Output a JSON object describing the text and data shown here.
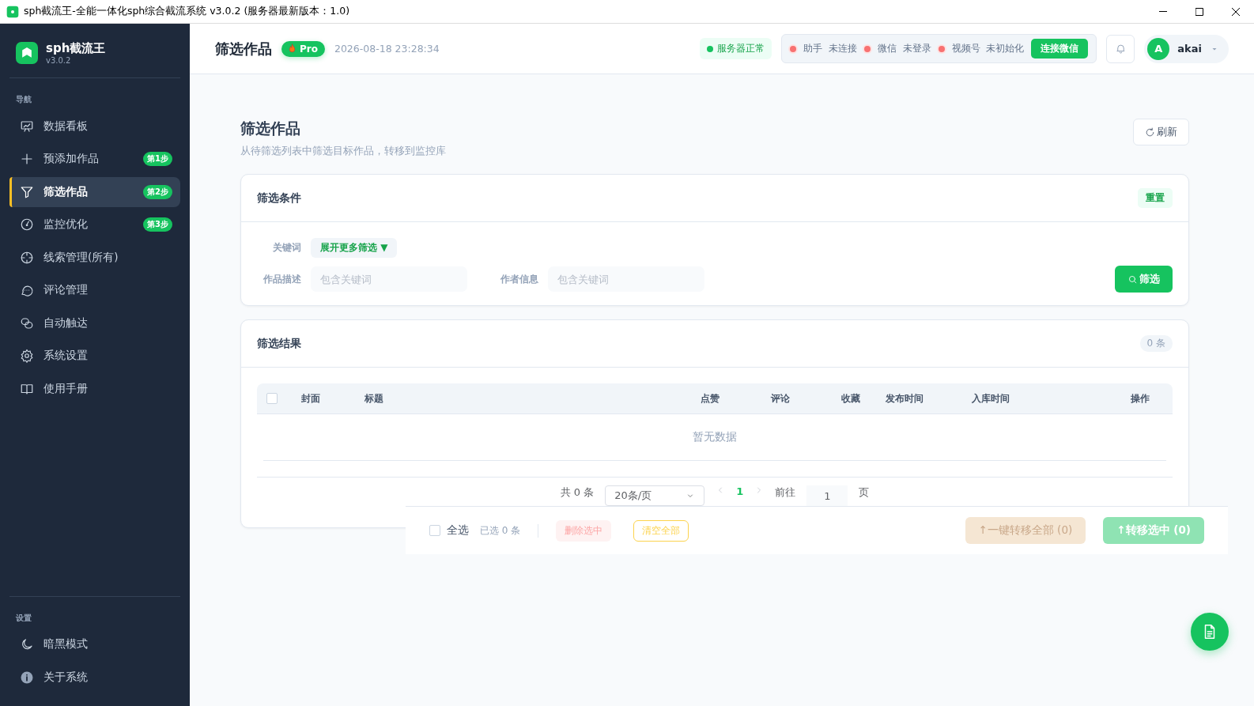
{
  "window": {
    "title": "sph截流王-全能一体化sph综合截流系统 v3.0.2 (服务器最新版本：1.0)"
  },
  "sidebar": {
    "brand": {
      "name": "sph截流王",
      "version": "v3.0.2"
    },
    "sections": [
      {
        "label": "导航",
        "items": [
          {
            "label": "数据看板",
            "selected": false
          },
          {
            "label": "预添加作品",
            "badge": "第1步",
            "selected": false
          },
          {
            "label": "筛选作品",
            "badge": "第2步",
            "selected": true
          },
          {
            "label": "监控优化",
            "badge": "第3步",
            "selected": false
          },
          {
            "label": "线索管理(所有)",
            "selected": false
          },
          {
            "label": "评论管理",
            "selected": false
          },
          {
            "label": "自动触达",
            "selected": false
          },
          {
            "label": "系统设置",
            "selected": false
          },
          {
            "label": "使用手册",
            "selected": false
          }
        ]
      },
      {
        "label": "设置",
        "items": [
          {
            "label": "暗黑模式",
            "selected": false
          },
          {
            "label": "关于系统",
            "selected": false
          }
        ]
      }
    ]
  },
  "header": {
    "title": "筛选作品",
    "badge": "Pro",
    "time": "2026-08-18 23:28:34",
    "server_status": {
      "label": "服务器正常",
      "ok": true
    },
    "statuses": [
      {
        "name": "助手",
        "value": "未连接",
        "ok": false
      },
      {
        "name": "微信",
        "value": "未登录",
        "ok": false
      },
      {
        "name": "视频号",
        "value": "未初始化",
        "ok": false
      }
    ],
    "connect_button": "连接微信",
    "user": {
      "avatar": "A",
      "name": "akai"
    }
  },
  "page": {
    "title": "筛选作品",
    "subtitle": "从待筛选列表中筛选目标作品，转移到监控库",
    "refresh_button": "刷新"
  },
  "filter": {
    "title": "筛选条件",
    "reset_button": "重置",
    "keyword_label": "关键词",
    "expand_button": "展开更多筛选 ▼",
    "fields": [
      {
        "label": "作品描述",
        "placeholder": "包含关键词"
      },
      {
        "label": "作者信息",
        "placeholder": "包含关键词"
      }
    ],
    "filter_button": "筛选"
  },
  "results": {
    "title": "筛选结果",
    "count": "0 条",
    "header_checked": false,
    "columns": [
      "封面",
      "标题",
      "点赞",
      "评论",
      "收藏",
      "发布时间",
      "入库时间",
      "操作"
    ],
    "empty": "暂无数据",
    "pagination": {
      "total": "共 0 条",
      "page_size": "20条/页",
      "pages": [
        {
          "label": "1",
          "selected": true
        }
      ],
      "goto_label": "前往",
      "goto_value": "1",
      "goto_suffix": "页"
    }
  },
  "bottom_bar": {
    "select_all": {
      "label": "全选",
      "checked": false
    },
    "selected_count": "已选 0 条",
    "buttons": [
      {
        "label": "删除选中",
        "kind": "danger",
        "disabled": true
      },
      {
        "label": "清空全部",
        "kind": "warning",
        "disabled": true
      },
      {
        "label": "↑一键转移全部 (0)",
        "kind": "orange",
        "disabled": true
      },
      {
        "label": "↑转移选中 (0)",
        "kind": "primary",
        "disabled": true
      }
    ]
  }
}
